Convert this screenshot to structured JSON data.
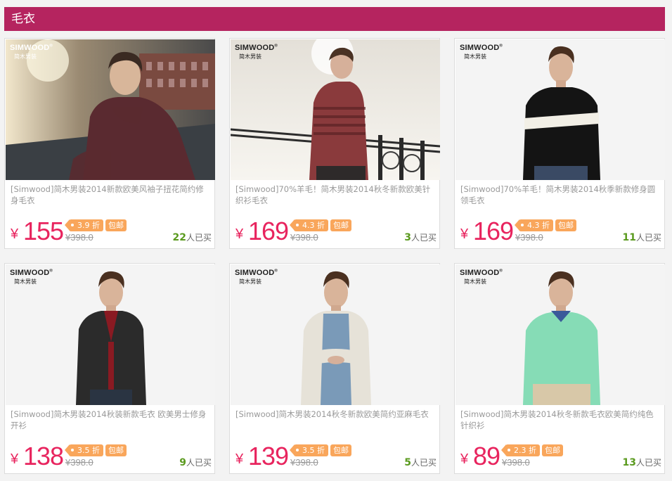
{
  "section": {
    "title": "毛衣"
  },
  "currency": "¥",
  "brand": {
    "name": "SIMWOOD",
    "registered": "®",
    "sub": "简木男装"
  },
  "products": [
    {
      "title": "[Simwood]简木男装2014新款欧美风袖子扭花简约修身毛衣",
      "price": "155",
      "discount": "3.9 折",
      "free_shipping": "包邮",
      "original_price": "398.0",
      "sold_count": "22",
      "sold_suffix": "人已买",
      "image": {
        "scene": "outdoor-dusk",
        "sweater_color": "#5a2a30",
        "brand_style": "light"
      }
    },
    {
      "title": "[Simwood]70%羊毛！简木男装2014秋冬新款欧美针织衫毛衣",
      "price": "169",
      "discount": "4.3 折",
      "free_shipping": "包邮",
      "original_price": "398.0",
      "sold_count": "3",
      "sold_suffix": "人已买",
      "image": {
        "scene": "bridge-bright",
        "sweater_color": "#8a3a3c",
        "brand_style": "dark"
      }
    },
    {
      "title": "[Simwood]70%羊毛！简木男装2014秋季新款修身圆领毛衣",
      "price": "169",
      "discount": "4.3 折",
      "free_shipping": "包邮",
      "original_price": "398.0",
      "sold_count": "11",
      "sold_suffix": "人已买",
      "image": {
        "scene": "studio",
        "sweater_color": "#141414",
        "stripe_color": "#f2efe6",
        "brand_style": "dark"
      }
    },
    {
      "title": "[Simwood]简木男装2014秋装新款毛衣 欧美男士修身开衫",
      "price": "138",
      "discount": "3.5 折",
      "free_shipping": "包邮",
      "original_price": "398.0",
      "sold_count": "9",
      "sold_suffix": "人已买",
      "image": {
        "scene": "studio",
        "sweater_color": "#2b2b2b",
        "shirt_color": "#8a1a22",
        "brand_style": "dark"
      }
    },
    {
      "title": "[Simwood]简木男装2014秋冬新款欧美简约亚麻毛衣",
      "price": "139",
      "discount": "3.5 折",
      "free_shipping": "包邮",
      "original_price": "398.0",
      "sold_count": "5",
      "sold_suffix": "人已买",
      "image": {
        "scene": "studio",
        "sweater_color": "#e6e2d8",
        "shirt_color": "#7a9ab8",
        "brand_style": "dark"
      }
    },
    {
      "title": "[Simwood]简木男装2014秋冬新款毛衣欧美简约纯色针织衫",
      "price": "89",
      "discount": "2.3 折",
      "free_shipping": "包邮",
      "original_price": "398.0",
      "sold_count": "13",
      "sold_suffix": "人已买",
      "image": {
        "scene": "studio",
        "sweater_color": "#86dcb6",
        "shirt_color": "#3a5a9a",
        "brand_style": "dark"
      }
    }
  ]
}
